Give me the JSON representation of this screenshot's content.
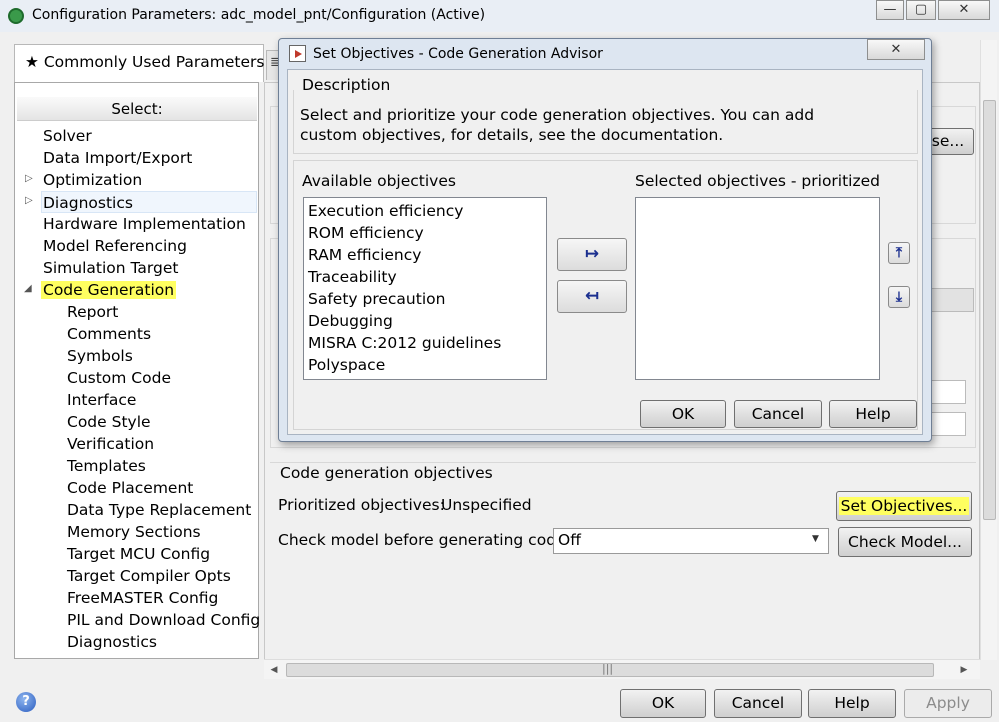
{
  "window": {
    "title": "Configuration Parameters: adc_model_pnt/Configuration (Active)",
    "minimize": "—",
    "restore": "▢",
    "close": "✕"
  },
  "tabs": {
    "commonly_used": "★ Commonly Used Parameters",
    "second_tab_prefix": "≣"
  },
  "sidebar": {
    "header": "Select:",
    "items": [
      {
        "label": "Solver"
      },
      {
        "label": "Data Import/Export"
      },
      {
        "label": "Optimization"
      },
      {
        "label": "Diagnostics"
      },
      {
        "label": "Hardware Implementation"
      },
      {
        "label": "Model Referencing"
      },
      {
        "label": "Simulation Target"
      },
      {
        "label": "Code Generation"
      }
    ],
    "children": [
      {
        "label": "Report"
      },
      {
        "label": "Comments"
      },
      {
        "label": "Symbols"
      },
      {
        "label": "Custom Code"
      },
      {
        "label": "Interface"
      },
      {
        "label": "Code Style"
      },
      {
        "label": "Verification"
      },
      {
        "label": "Templates"
      },
      {
        "label": "Code Placement"
      },
      {
        "label": "Data Type Replacement"
      },
      {
        "label": "Memory Sections"
      },
      {
        "label": "Target MCU Config"
      },
      {
        "label": "Target Compiler Opts"
      },
      {
        "label": "FreeMASTER Config"
      },
      {
        "label": "PIL and Download Config"
      },
      {
        "label": "Diagnostics"
      }
    ]
  },
  "main": {
    "browse_label": "se...",
    "objectives_group": "Code generation objectives",
    "prioritized_label": "Prioritized objectives:",
    "prioritized_value": "Unspecified",
    "set_objectives_button": "Set Objectives...",
    "check_model_label": "Check model before generating code:",
    "check_model_value": "Off",
    "check_model_button": "Check Model..."
  },
  "footer": {
    "ok": "OK",
    "cancel": "Cancel",
    "help": "Help",
    "apply": "Apply"
  },
  "dialog": {
    "title": "Set Objectives - Code Generation Advisor",
    "close": "✕",
    "description_header": "Description",
    "description_text": "Select and prioritize your code generation objectives. You can add custom objectives, for details, see the documentation.",
    "available_label": "Available objectives",
    "selected_label": "Selected objectives - prioritized",
    "available_items": [
      {
        "label": "Execution efficiency"
      },
      {
        "label": "ROM efficiency"
      },
      {
        "label": "RAM efficiency"
      },
      {
        "label": "Traceability"
      },
      {
        "label": "Safety precaution"
      },
      {
        "label": "Debugging"
      },
      {
        "label": "MISRA C:2012 guidelines"
      },
      {
        "label": "Polyspace"
      }
    ],
    "add_arrow": "↦",
    "remove_arrow": "↤",
    "move_up": "⤒",
    "move_down": "⤓",
    "ok": "OK",
    "cancel": "Cancel",
    "help": "Help"
  }
}
